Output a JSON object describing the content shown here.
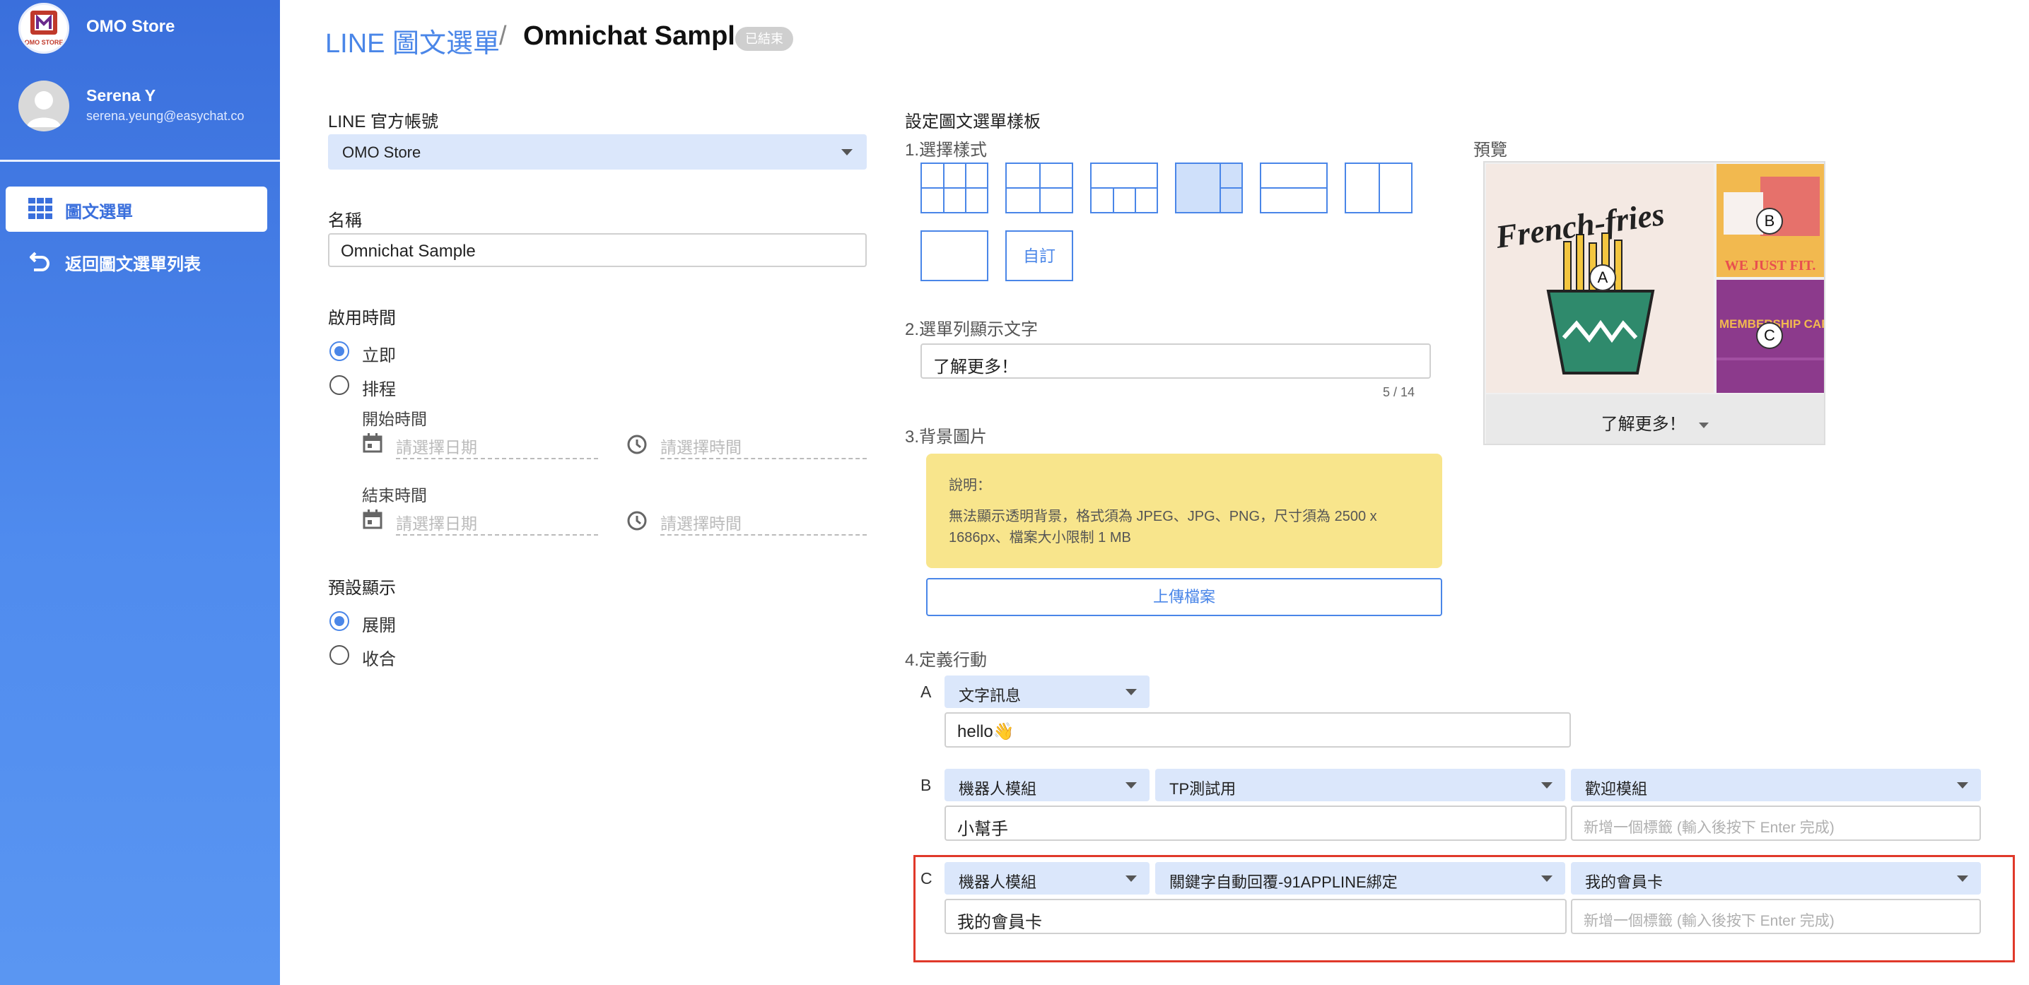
{
  "sidebar": {
    "store_logo_text": "OMO STORE",
    "store_name": "OMO Store",
    "user_name": "Serena Y",
    "user_email": "serena.yeung@easychat.co",
    "nav": [
      {
        "label": "圖文選單"
      },
      {
        "label": "返回圖文選單列表"
      }
    ]
  },
  "header": {
    "breadcrumb_link": "LINE 圖文選單",
    "separator": "/",
    "title": "Omnichat Sample",
    "status_badge": "已結束"
  },
  "form": {
    "account_label": "LINE 官方帳號",
    "account_value": "OMO Store",
    "name_label": "名稱",
    "name_value": "Omnichat Sample",
    "start_label": "啟用時間",
    "start_options": [
      {
        "label": "立即",
        "selected": true
      },
      {
        "label": "排程",
        "selected": false
      }
    ],
    "start_time_label": "開始時間",
    "end_time_label": "結束時間",
    "date_placeholder": "請選擇日期",
    "time_placeholder": "請選擇時間",
    "default_label": "預設顯示",
    "default_options": [
      {
        "label": "展開",
        "selected": true
      },
      {
        "label": "收合",
        "selected": false
      }
    ]
  },
  "template": {
    "section_title": "設定圖文選單樣板",
    "step1_label": "1.選擇樣式",
    "custom_label": "自訂",
    "step2_label": "2.選單列顯示文字",
    "menu_text_value": "了解更多！",
    "menu_text_counter": "5 / 14",
    "step3_label": "3.背景圖片",
    "note_title": "說明：",
    "note_body": "無法顯示透明背景，格式須為 JPEG、JPG、PNG，尺寸須為 2500 x 1686px、檔案大小限制 1 MB",
    "upload_label": "上傳檔案",
    "step4_label": "4.定義行動",
    "actions": {
      "a": {
        "letter": "A",
        "type": "文字訊息",
        "text": "hello👋"
      },
      "b": {
        "letter": "B",
        "type": "機器人模組",
        "module": "TP測試用",
        "sub": "歡迎模組",
        "name": "小幫手",
        "tag_placeholder": "新增一個標籤 (輸入後按下 Enter 完成)"
      },
      "c": {
        "letter": "C",
        "type": "機器人模組",
        "module": "關鍵字自動回覆-91APPLINE綁定",
        "sub": "我的會員卡",
        "name": "我的會員卡",
        "tag_placeholder": "新增一個標籤 (輸入後按下 Enter 完成)"
      }
    }
  },
  "preview": {
    "label": "預覽",
    "image_a_text": "French-fries",
    "image_b_text": "WE JUST FIT.",
    "image_c_text": "MEMBERSHIP CARD",
    "markers": [
      "A",
      "B",
      "C"
    ],
    "bar_label": "了解更多！"
  },
  "colors": {
    "primary": "#4a86e8",
    "sidebar": "#3a6fdc",
    "highlight": "#e0392a",
    "note_bg": "#f8e58c",
    "select_bg": "#dbe7fb"
  }
}
